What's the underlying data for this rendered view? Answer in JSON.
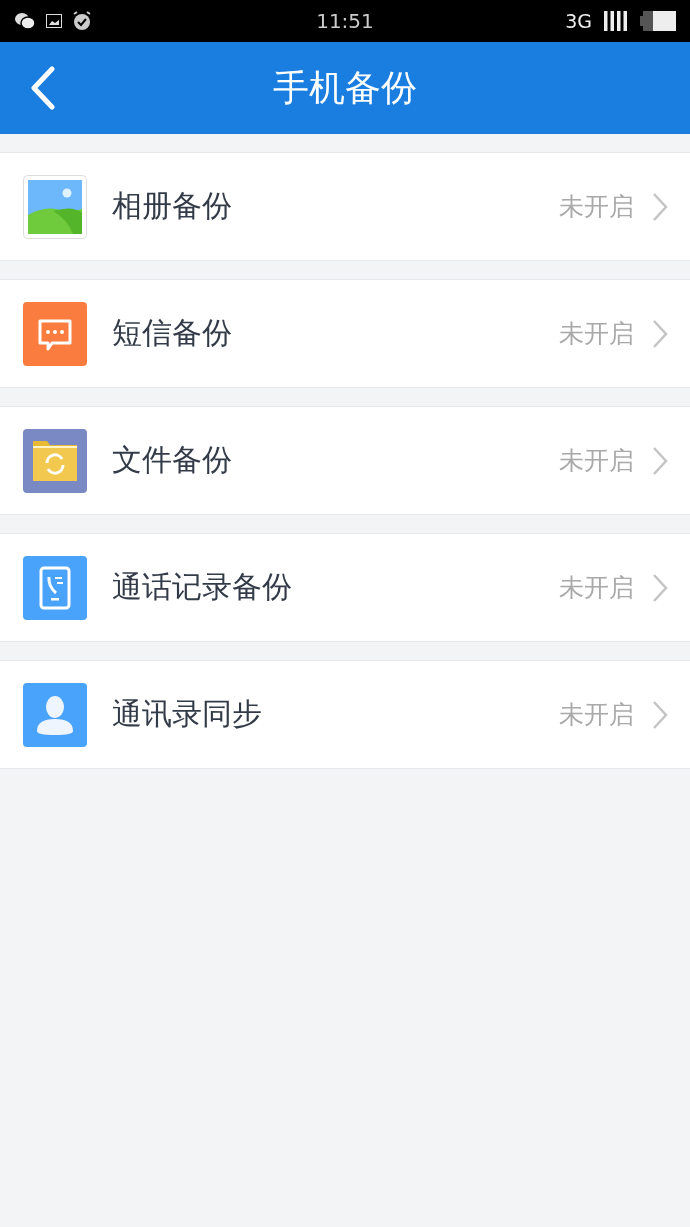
{
  "status_bar": {
    "time": "11:51",
    "network": "3G"
  },
  "header": {
    "title": "手机备份"
  },
  "items": [
    {
      "kind": "photos",
      "label": "相册备份",
      "status": "未开启"
    },
    {
      "kind": "sms",
      "label": "短信备份",
      "status": "未开启"
    },
    {
      "kind": "files",
      "label": "文件备份",
      "status": "未开启"
    },
    {
      "kind": "calls",
      "label": "通话记录备份",
      "status": "未开启"
    },
    {
      "kind": "contacts",
      "label": "通讯录同步",
      "status": "未开启"
    }
  ]
}
